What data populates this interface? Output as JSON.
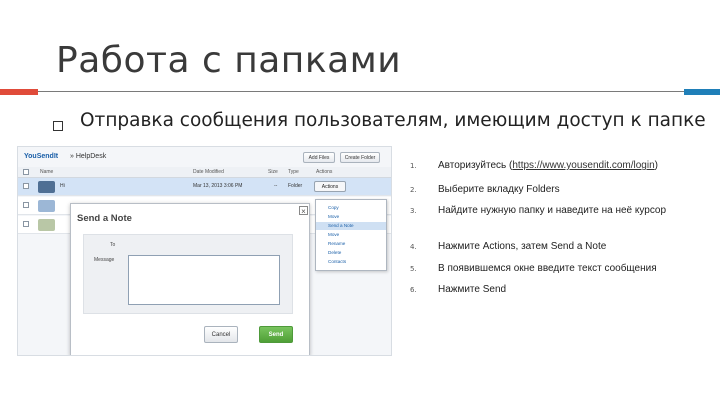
{
  "slide": {
    "title": "Работа с папками",
    "bullet": "Отправка сообщения пользователям, имеющим доступ к папке"
  },
  "app": {
    "logo": "YouSendIt",
    "breadcrumb": "HelpDesk",
    "buttons": [
      "Add Files",
      "Create Folder"
    ],
    "columns": [
      "Name",
      "Date Modified",
      "Size",
      "Type",
      "Actions"
    ],
    "rows": [
      {
        "name": "",
        "selected": false
      },
      {
        "name": "Hi",
        "date": "Mar 13, 2013 3:06 PM",
        "size": "--",
        "type": "Folder",
        "action": "Actions",
        "selected": true
      },
      {
        "name": "",
        "selected": false
      },
      {
        "name": "",
        "selected": false
      }
    ],
    "dropdown": [
      "Copy",
      "Move",
      "Send a Note",
      "Move",
      "Rename",
      "Delete",
      "Contacts"
    ],
    "dropdown_highlight_index": 2
  },
  "modal": {
    "title": "Send a Note",
    "close": "×",
    "to_label": "To",
    "message_label": "Message",
    "message_value": "",
    "cancel": "Cancel",
    "send": "Send"
  },
  "steps": [
    {
      "num": "1.",
      "text_before": "Авторизуйтесь (",
      "link": "https://www.yousendit.com/login",
      "text_after": ")"
    },
    {
      "num": "2.",
      "text": "Выберите вкладку Folders"
    },
    {
      "num": "3.",
      "text": "Найдите нужную папку и наведите на неё курсор"
    },
    {
      "num": "4.",
      "text": "Нажмите Actions, затем Send a Note"
    },
    {
      "num": "5.",
      "text": "В появившемся окне введите текст сообщения"
    },
    {
      "num": "6.",
      "text": "Нажмите Send"
    }
  ],
  "colors": {
    "accent_left": "#e04b3a",
    "accent_right": "#1f7fb8",
    "send_button": "#5aab3f",
    "selected_row": "#d3e3f6"
  }
}
